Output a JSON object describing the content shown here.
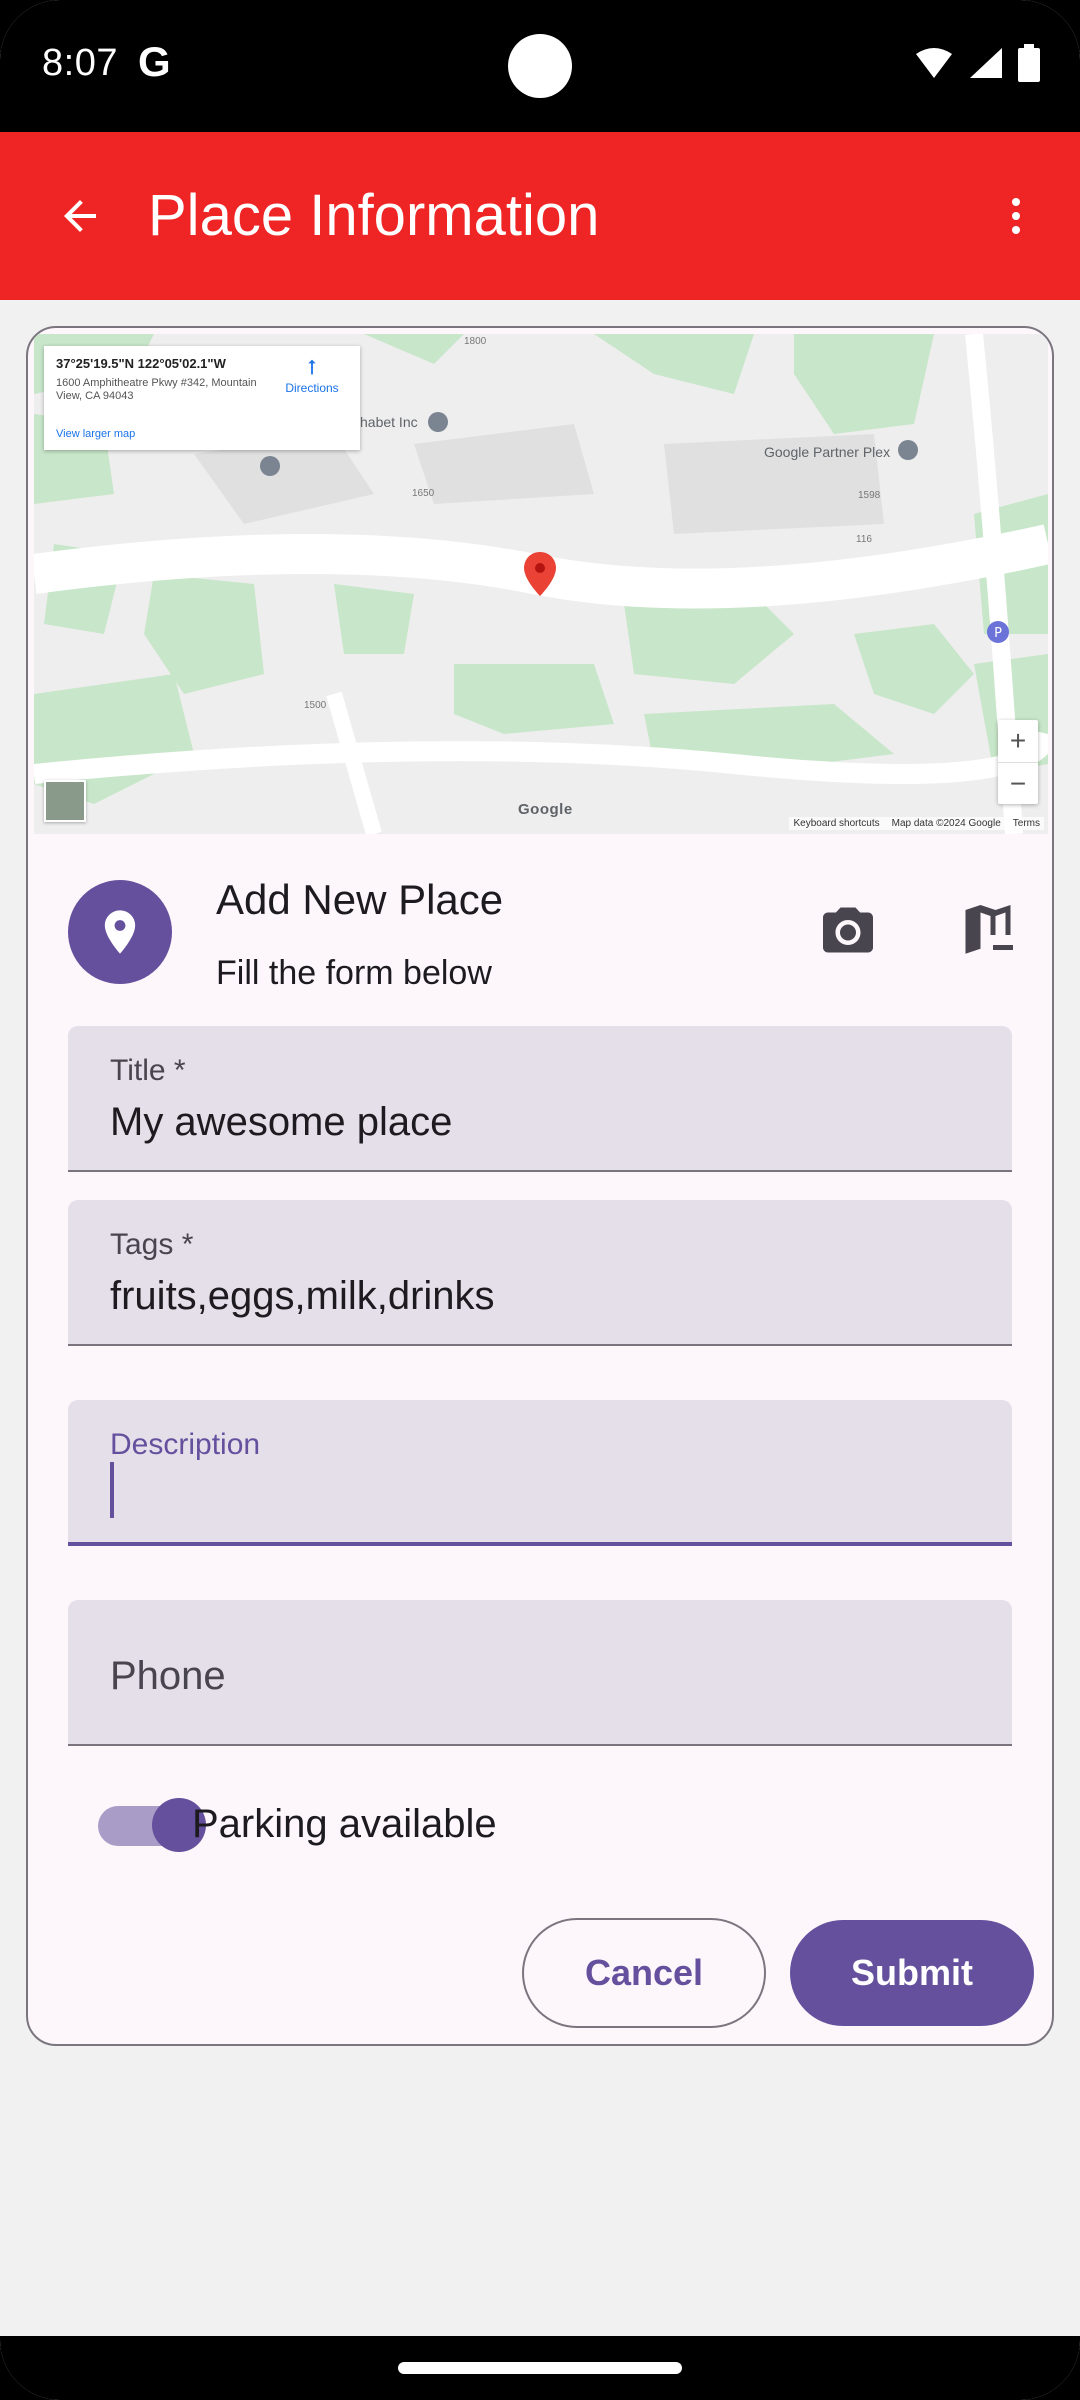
{
  "status_bar": {
    "time": "8:07",
    "g_icon": "G"
  },
  "app_bar": {
    "title": "Place Information",
    "back_icon": "arrow-back-icon",
    "menu_icon": "more-vert-icon",
    "color": "#ee2425"
  },
  "map": {
    "coords": "37°25'19.5\"N 122°05'02.1\"W",
    "address": "1600 Amphitheatre Pkwy #342, Mountain View, CA 94043",
    "view_larger": "View larger map",
    "directions": "Directions",
    "label_alphabet": "habet Inc",
    "label_partner": "Google Partner Plex",
    "numbers": [
      "1800",
      "1650",
      "1598",
      "116",
      "1500"
    ],
    "zoom_in": "+",
    "zoom_out": "−",
    "google_logo": "Google",
    "footer": {
      "shortcuts": "Keyboard shortcuts",
      "data": "Map data ©2024 Google",
      "terms": "Terms"
    }
  },
  "header": {
    "title": "Add New Place",
    "subtitle": "Fill the form below",
    "avatar_icon": "location-pin-icon",
    "camera_icon": "camera-icon",
    "map_icon": "map-icon"
  },
  "form": {
    "title": {
      "label": "Title *",
      "value": "My awesome place"
    },
    "tags": {
      "label": "Tags *",
      "value": "fruits,eggs,milk,drinks"
    },
    "description": {
      "label": "Description",
      "value": ""
    },
    "phone": {
      "placeholder": "Phone"
    },
    "parking": {
      "label": "Parking available",
      "checked": true
    }
  },
  "actions": {
    "cancel": "Cancel",
    "submit": "Submit"
  },
  "colors": {
    "primary": "#65509e",
    "field_bg": "#e5dfea",
    "card_bg": "#fdf7fb"
  }
}
